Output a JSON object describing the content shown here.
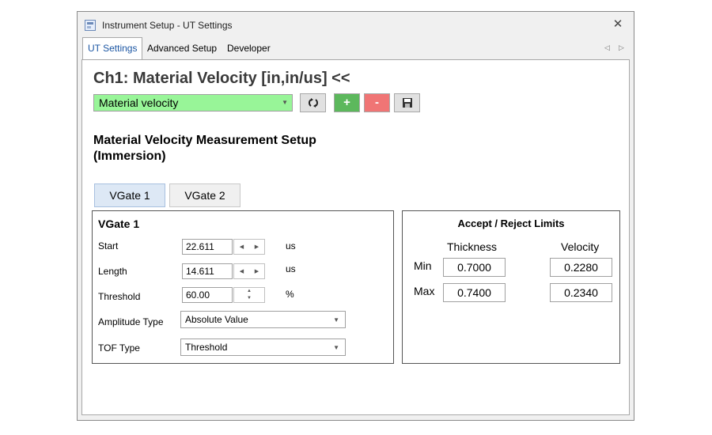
{
  "window": {
    "title": "Instrument Setup - UT Settings"
  },
  "tabs": [
    "UT Settings",
    "Advanced Setup",
    "Developer"
  ],
  "heading": "Ch1: Material Velocity [in,in/us] <<",
  "measurement_combo": {
    "value": "Material velocity"
  },
  "toolbar": {
    "add_label": "+",
    "remove_label": "-"
  },
  "setup_title": {
    "line1": "Material Velocity Measurement Setup",
    "line2": "(Immersion)"
  },
  "vgate_tabs": [
    "VGate 1",
    "VGate 2"
  ],
  "vgate": {
    "title": "VGate 1",
    "start": {
      "label": "Start",
      "value": "22.611",
      "unit": "us"
    },
    "length": {
      "label": "Length",
      "value": "14.611",
      "unit": "us"
    },
    "threshold": {
      "label": "Threshold",
      "value": "60.00",
      "unit": "%"
    },
    "amplitude_type": {
      "label": "Amplitude Type",
      "value": "Absolute Value"
    },
    "tof_type": {
      "label": "TOF Type",
      "value": "Threshold"
    }
  },
  "limits": {
    "title": "Accept / Reject Limits",
    "columns": [
      "Thickness",
      "Velocity"
    ],
    "min": {
      "label": "Min",
      "thickness": "0.7000",
      "velocity": "0.2280"
    },
    "max": {
      "label": "Max",
      "thickness": "0.7400",
      "velocity": "0.2340"
    }
  },
  "icons": {
    "close": "close-icon",
    "refresh": "refresh-icon",
    "save": "floppy-disk-icon"
  },
  "colors": {
    "combo_green": "#98f598",
    "add_green": "#5cb85c",
    "remove_red": "#f07575",
    "active_tab_text": "#1b56a3"
  }
}
